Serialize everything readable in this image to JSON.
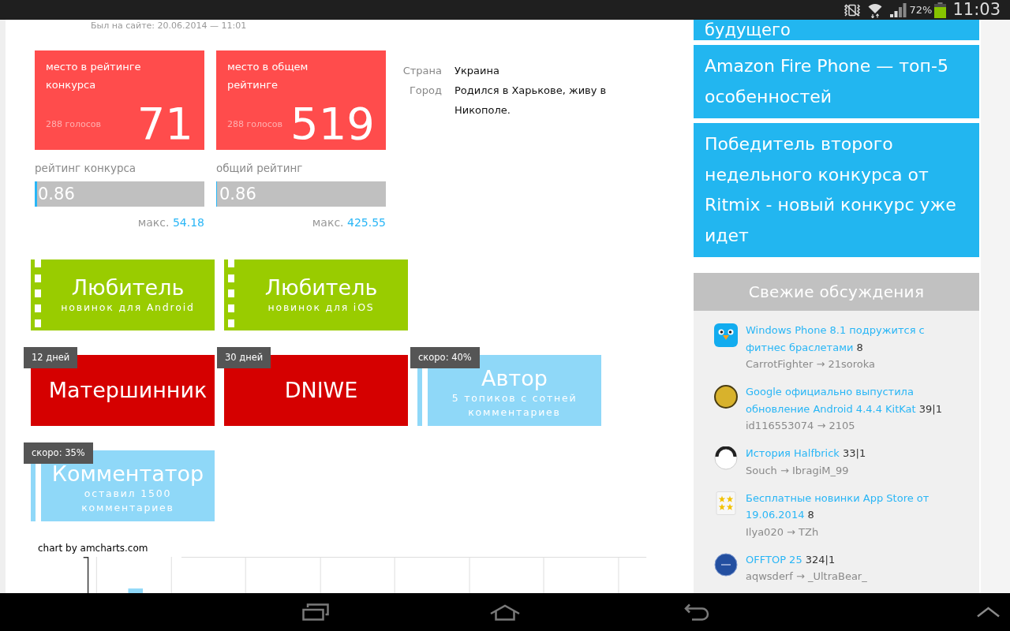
{
  "status_bar": {
    "battery_text": "72%",
    "time": "11:03"
  },
  "profile": {
    "last_seen": "Был на сайте: 20.06.2014 — 11:01",
    "rank_cards": [
      {
        "label": "место в рейтинге конкурса",
        "votes": "288 голосов",
        "place": "71",
        "rating_label": "рейтинг конкурса",
        "rating": "0.86",
        "level": 0.016,
        "max_label": "макс.",
        "max": "54.18"
      },
      {
        "label": "место в общем рейтинге",
        "votes": "288 голосов",
        "place": "519",
        "rating_label": "общий рейтинг",
        "rating": "0.86",
        "level": 0.002,
        "max_label": "макс.",
        "max": "425.55"
      }
    ],
    "info": [
      {
        "label": "Страна",
        "value": "Украина"
      },
      {
        "label": "Город",
        "value": "Родился в Харькове, живу в Никополе."
      }
    ]
  },
  "badge_rows": [
    [
      {
        "kind": "dashed",
        "color": "#99cc00",
        "title": "Любитель",
        "subtitle": "новинок для Android"
      },
      {
        "kind": "dashed",
        "color": "#99cc00",
        "title": "Любитель",
        "subtitle": "новинок для iOS"
      }
    ],
    [
      {
        "kind": "plain",
        "color": "#d50000",
        "title": "Матершинник",
        "tag": "12 дней"
      },
      {
        "kind": "plain",
        "color": "#d50000",
        "title": "DNIWE",
        "tag": "30 дней"
      },
      {
        "kind": "split",
        "color": "#8fd8f8",
        "title": "Автор",
        "subtitle": "5 топиков с сотней комментариев",
        "tag": "скоро: 40%"
      }
    ],
    [
      {
        "kind": "split",
        "color": "#8fd8f8",
        "title": "Комментатор",
        "subtitle": "оставил 1500 комментариев",
        "tag": "скоро: 35%"
      }
    ]
  ],
  "chart": {
    "credit": "chart by amcharts.com"
  },
  "sidebar": {
    "cut_post": "будущего",
    "posts": [
      "Amazon Fire Phone — топ-5 особенностей",
      "Победитель второго недельного конкурса от Ritmix - новый конкурс уже идет"
    ],
    "discussions": {
      "title": "Свежие обсуждения",
      "items": [
        {
          "title": "Windows Phone 8.1 подружится с фитнес браслетами",
          "count": "8",
          "authors": "CarrotFighter → 21soroka"
        },
        {
          "title": "Google официально выпустила обновление Android 4.4.4 KitKat",
          "count": "39|1",
          "authors": "id116553074 → 2105"
        },
        {
          "title": "История Halfbrick",
          "count": "33|1",
          "authors": "Souch → IbragiM_99"
        },
        {
          "title": "Бесплатные новинки App Store от 19.06.2014",
          "count": "8",
          "authors": "Ilya020 → TZh"
        },
        {
          "title": "OFFTOP 25",
          "count": "324|1",
          "authors": "aqwsderf → _UltraBear_"
        }
      ]
    }
  }
}
